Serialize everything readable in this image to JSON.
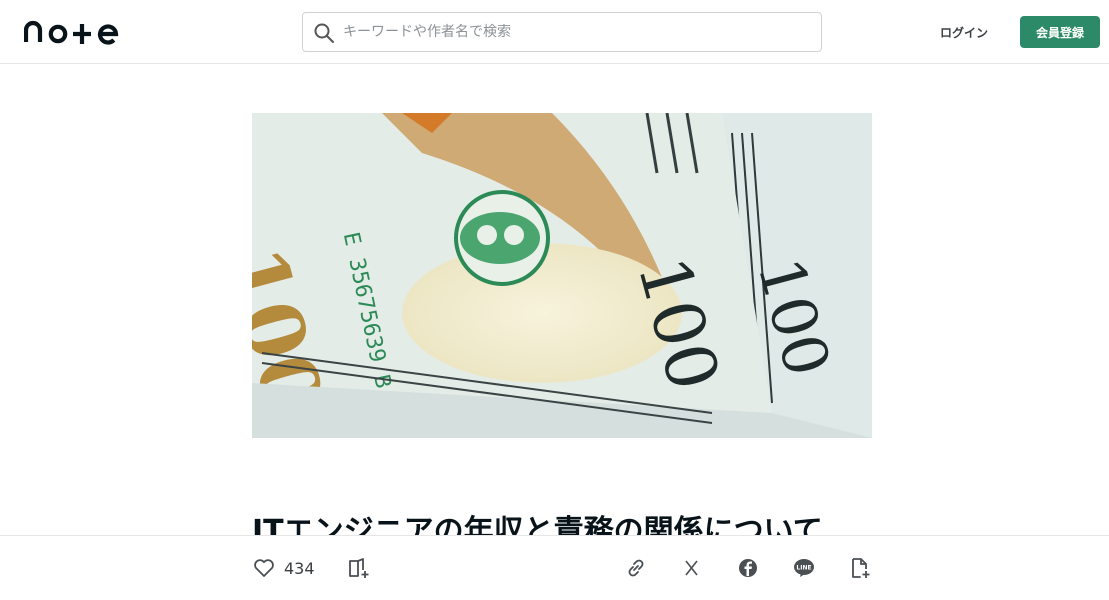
{
  "header": {
    "logo": "note",
    "search_placeholder": "キーワードや作者名で検索",
    "login_label": "ログイン",
    "signup_label": "会員登録"
  },
  "article": {
    "title": "ITエンジニアの年収と責務の関係について"
  },
  "actions": {
    "like_count": "434"
  },
  "colors": {
    "brand_green": "#2d8a69",
    "text": "#08131a",
    "border": "#e6e6e6"
  },
  "icons": [
    "search-icon",
    "heart-icon",
    "magazine-add-icon",
    "link-icon",
    "x-icon",
    "facebook-icon",
    "line-icon",
    "embed-icon"
  ]
}
